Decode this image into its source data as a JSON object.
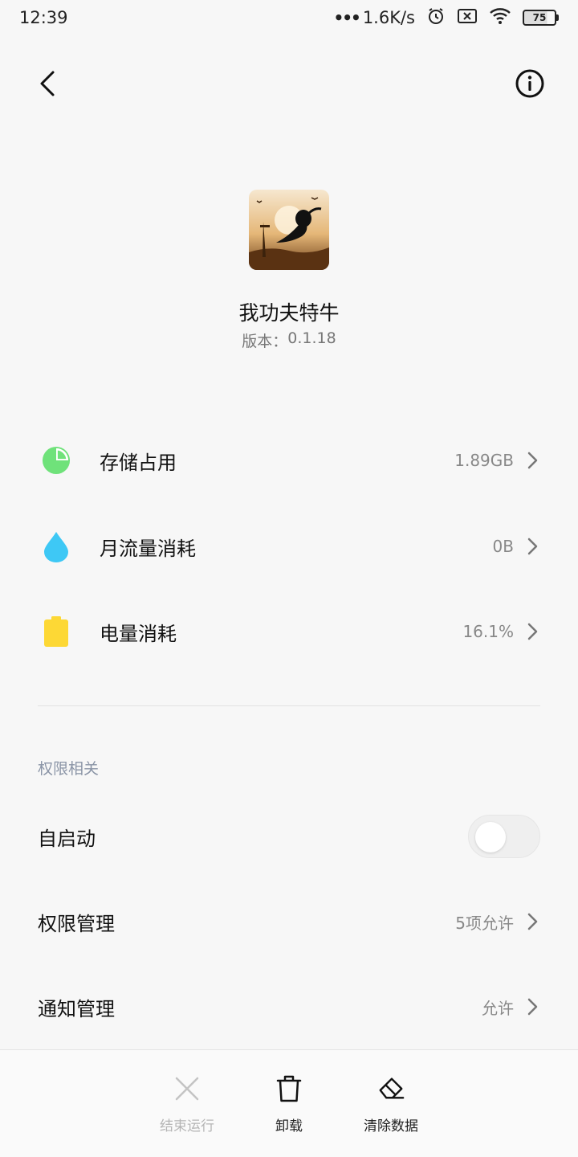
{
  "status_bar": {
    "time": "12:39",
    "net_speed": "1.6K/s",
    "battery": "75",
    "icons": [
      "signal-dots-icon",
      "alarm-icon",
      "sim-x-icon",
      "wifi-icon",
      "battery-icon"
    ]
  },
  "header": {
    "back_icon": "back-arrow-icon",
    "info_icon": "info-icon"
  },
  "app": {
    "name": "我功夫特牛",
    "version_label": "版本：",
    "version": "0.1.18"
  },
  "usage": [
    {
      "label": "存储占用",
      "value": "1.89GB",
      "icon": "pie-chart-icon",
      "color": "#6fe27a"
    },
    {
      "label": "月流量消耗",
      "value": "0B",
      "icon": "water-drop-icon",
      "color": "#3ec8f5"
    },
    {
      "label": "电量消耗",
      "value": "16.1%",
      "icon": "battery-usage-icon",
      "color": "#fdd835"
    }
  ],
  "permissions": {
    "section_title": "权限相关",
    "autostart_label": "自启动",
    "autostart_enabled": false,
    "perm_label": "权限管理",
    "perm_value": "5项允许",
    "notif_label": "通知管理",
    "notif_value": "允许"
  },
  "bottom_actions": [
    {
      "label": "结束运行",
      "icon": "close-x-icon",
      "enabled": false
    },
    {
      "label": "卸载",
      "icon": "trash-icon",
      "enabled": true
    },
    {
      "label": "清除数据",
      "icon": "eraser-icon",
      "enabled": true
    }
  ]
}
